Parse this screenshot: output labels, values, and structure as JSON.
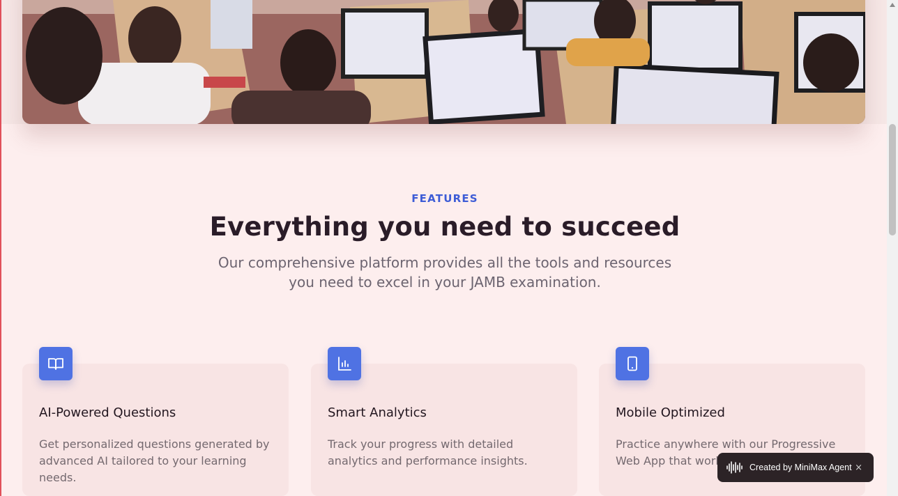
{
  "hero": {
    "image_icon": "classroom-photo"
  },
  "features": {
    "eyebrow": "FEATURES",
    "headline": "Everything you need to succeed",
    "subtitle": "Our comprehensive platform provides all the tools and resources you need to excel in your JAMB examination."
  },
  "cards": [
    {
      "icon": "book-open-icon",
      "title": "AI-Powered Questions",
      "text": "Get personalized questions generated by advanced AI tailored to your learning needs."
    },
    {
      "icon": "bar-chart-icon",
      "title": "Smart Analytics",
      "text": "Track your progress with detailed analytics and performance insights."
    },
    {
      "icon": "smartphone-icon",
      "title": "Mobile Optimized",
      "text": "Practice anywhere with our Progressive Web App that works like a native app."
    }
  ],
  "badge": {
    "label": "Created by MiniMax Agent",
    "close": "×",
    "logo_icon": "soundwave-logo-icon"
  },
  "colors": {
    "accent": "#3d5cd6",
    "icon_bg": "#4f72e3",
    "page_bg": "#fdeeee",
    "card_bg": "#f8e4e4",
    "badge_bg": "#2c2326"
  }
}
